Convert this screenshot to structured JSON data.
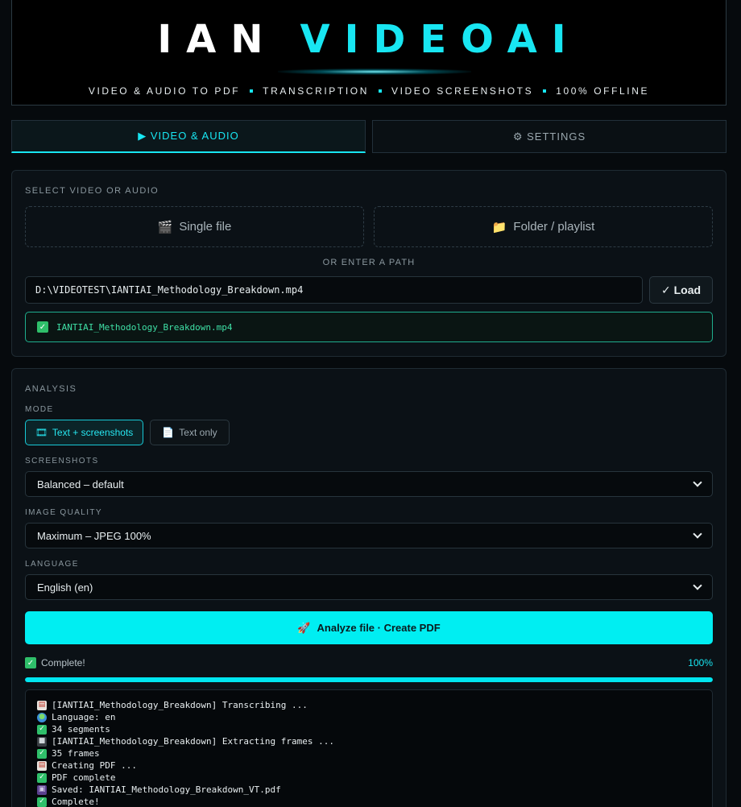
{
  "header": {
    "logo_part1": "IAN",
    "logo_part2": "VIDEOAI",
    "tagline": [
      "VIDEO & AUDIO TO PDF",
      "TRANSCRIPTION",
      "VIDEO SCREENSHOTS",
      "100% OFFLINE"
    ]
  },
  "tabs": [
    {
      "label": "▶ VIDEO & AUDIO",
      "active": true
    },
    {
      "label": "⚙ SETTINGS",
      "active": false
    }
  ],
  "select_card": {
    "title": "SELECT VIDEO OR AUDIO",
    "single_file": {
      "icon": "🎬",
      "label": "Single file"
    },
    "folder": {
      "icon": "📁",
      "label": "Folder / playlist"
    },
    "or_text": "OR ENTER A PATH",
    "path_value": "D:\\VIDEOTEST\\IANTIAI_Methodology_Breakdown.mp4",
    "load_label": "✓ Load",
    "loaded_file": "IANTIAI_Methodology_Breakdown.mp4"
  },
  "analysis": {
    "title": "ANALYSIS",
    "mode_label": "MODE",
    "mode_on": {
      "icon": "🎞",
      "label": "Text + screenshots"
    },
    "mode_off": {
      "icon": "📄",
      "label": "Text only"
    },
    "screenshots_label": "SCREENSHOTS",
    "screenshots_value": "Balanced – default",
    "quality_label": "IMAGE QUALITY",
    "quality_value": "Maximum – JPEG 100%",
    "language_label": "LANGUAGE",
    "language_value": "English (en)",
    "analyze_icon": "🚀",
    "analyze_label": "Analyze file · Create PDF",
    "status_text": "Complete!",
    "percent_text": "100%",
    "progress": 1.0
  },
  "log": [
    {
      "icon": "doc",
      "text": "[IANTIAI_Methodology_Breakdown] Transcribing ..."
    },
    {
      "icon": "globe",
      "text": "Language: en"
    },
    {
      "icon": "check",
      "text": "34 segments"
    },
    {
      "icon": "cam",
      "text": "[IANTIAI_Methodology_Breakdown] Extracting frames ..."
    },
    {
      "icon": "check",
      "text": "35 frames"
    },
    {
      "icon": "doc",
      "text": "Creating PDF ..."
    },
    {
      "icon": "check",
      "text": "PDF complete"
    },
    {
      "icon": "disk",
      "text": "Saved: IANTIAI_Methodology_Breakdown_VT.pdf"
    },
    {
      "icon": "check",
      "text": "Complete!"
    }
  ],
  "colors": {
    "accent": "#18e6f2",
    "success": "#2fbf6a",
    "background": "#060a0d"
  }
}
